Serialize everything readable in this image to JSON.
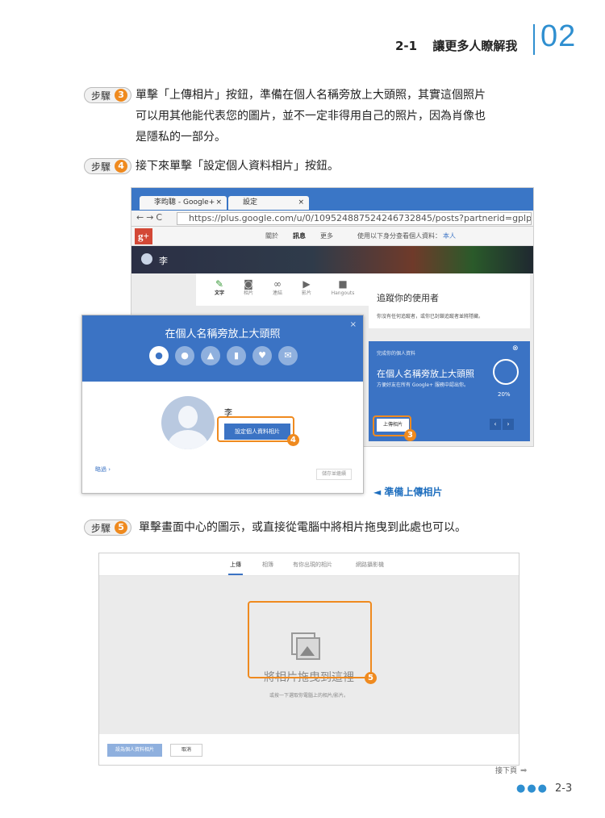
{
  "header": {
    "section": "2-1",
    "title": "讓更多人瞭解我",
    "chapter": "02"
  },
  "steps": [
    {
      "label": "步驟",
      "number": "3",
      "line1": "單擊「上傳相片」按鈕，準備在個人名稱旁放上大頭照，其實這個照片",
      "line2": "可以用其他能代表您的圖片，並不一定非得用自己的照片，因為肖像也",
      "line3": "是隱私的一部分。"
    },
    {
      "label": "步驟",
      "number": "4",
      "line1": "接下來單擊「設定個人資料相片」按鈕。"
    },
    {
      "label": "步驟",
      "number": "5",
      "line1": "單擊畫面中心的圖示，或直接從電腦中將相片拖曳到此處也可以。"
    }
  ],
  "shot1": {
    "tab1": "李昀聰 - Google+",
    "tab2": "設定",
    "url": "https://plus.google.com/u/0/109524887524246732845/posts?partnerid=gplp0",
    "gplus": "g+",
    "nav": {
      "discover": "關於",
      "posts": "訊息",
      "more": "更多",
      "view_as": "使用以下身分查看個人資料：",
      "self": "本人"
    },
    "profile_name": "李",
    "compose": [
      {
        "glyph": "✎",
        "label": "文字"
      },
      {
        "glyph": "◙",
        "label": "相片"
      },
      {
        "glyph": "∞",
        "label": "連結"
      },
      {
        "glyph": "▶",
        "label": "影片"
      },
      {
        "glyph": "■",
        "label": "Hangouts"
      }
    ],
    "track_title": "追蹤你的使用者",
    "track_sub": "你沒有任何追蹤者，或你已封鎖追蹤者並將隱藏。",
    "promo": {
      "small": "完成你的個人資料",
      "big": "在個人名稱旁放上大頭照",
      "sub": "方便好友在所有 Google+ 服務中認出你。",
      "pct": "20%",
      "upload": "上傳相片"
    }
  },
  "dialog": {
    "title": "在個人名稱旁放上大頭照",
    "close": "×",
    "icons": [
      "●",
      "●",
      "▲",
      "▮",
      "♥",
      "✉"
    ],
    "name": "李",
    "set_button": "設定個人資料相片",
    "skip": "略過 ›",
    "save": "儲存並繼續"
  },
  "badges": {
    "b3": "3",
    "b4": "4",
    "b5": "5"
  },
  "caption": "◄ 準備上傳相片",
  "shot2": {
    "tabs": [
      "上傳",
      "相簿",
      "有你出現的相片",
      "網路攝影機"
    ],
    "drop_text": "將相片拖曳到這裡",
    "drop_sub": "或按一下選取你電腦上的相片/影片。",
    "btn_set": "設為個人資料相片",
    "btn_cancel": "取消"
  },
  "footer": {
    "next": "接下頁",
    "dots": "●●●",
    "page": "2-3"
  }
}
